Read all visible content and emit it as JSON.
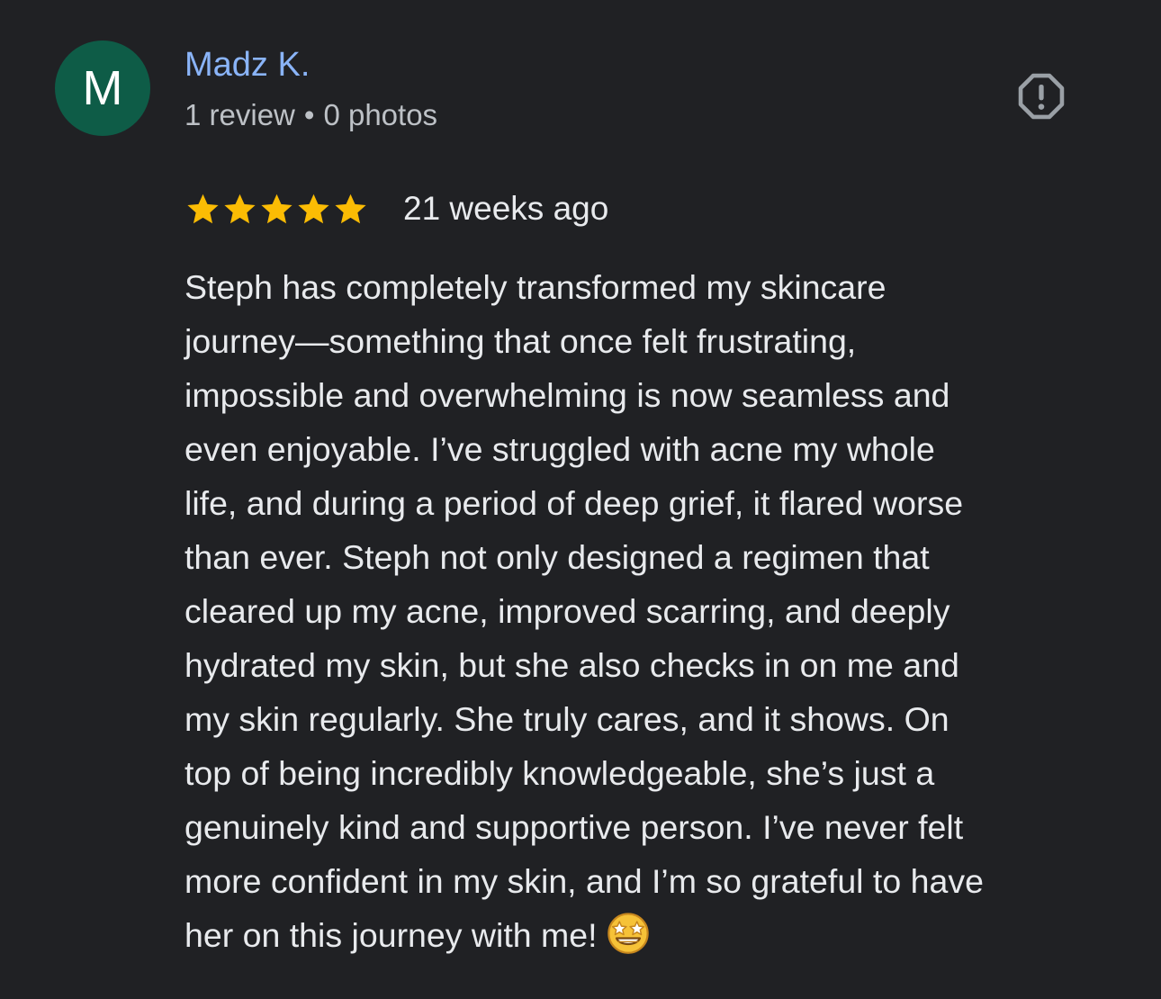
{
  "review": {
    "avatar_letter": "M",
    "author_name": "Madz K.",
    "review_count": "1 review",
    "separator": "•",
    "photo_count": "0 photos",
    "report_icon": "report-flag-icon",
    "rating": 5,
    "rating_max": 5,
    "date": "21 weeks ago",
    "text": "Steph has completely transformed my skincare\njourney—something that once felt frustrating,\nimpossible and overwhelming is now seamless and\neven enjoyable. I’ve struggled with acne my whole\nlife, and during a period of deep grief, it flared worse\nthan ever. Steph not only designed a regimen that\ncleared up my acne, improved scarring, and deeply\nhydrated my skin, but she also checks in on me and\nmy skin regularly. She truly cares, and it shows. On\ntop of being incredibly knowledgeable, she’s just a\ngenuinely kind and supportive person. I’ve never felt\nmore confident in my skin, and I’m so grateful to have\nher on this journey with me!",
    "emoji": "star-struck-emoji-icon"
  },
  "colors": {
    "background": "#202124",
    "avatar": "#0e5c47",
    "author_name": "#8ab4f8",
    "meta": "#bdc1c6",
    "star": "#fbbc04",
    "icon": "#9aa0a6"
  }
}
